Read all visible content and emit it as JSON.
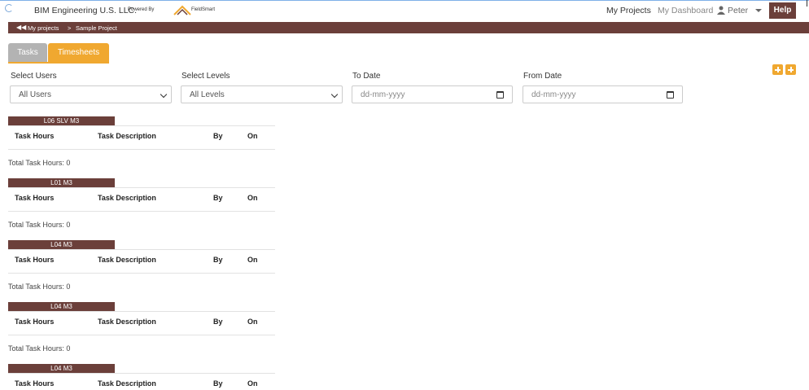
{
  "header": {
    "company": "BIM Engineering U.S. LLC.",
    "powered_by": "Powered By",
    "logo_text": "FieldSmart",
    "nav": {
      "my_projects": "My Projects",
      "my_dashboard": "My Dashboard",
      "user": "Peter",
      "help": "Help"
    }
  },
  "breadcrumb": {
    "root": "My projects",
    "separator": ">",
    "current": "Sample Project"
  },
  "tabs": [
    {
      "label": "Tasks",
      "active": false
    },
    {
      "label": "Timesheets",
      "active": true
    }
  ],
  "filters": {
    "users": {
      "label": "Select Users",
      "value": "All Users"
    },
    "levels": {
      "label": "Select Levels",
      "value": "All Levels"
    },
    "to_date": {
      "label": "To Date",
      "placeholder": "dd-mm-yyyy"
    },
    "from_date": {
      "label": "From Date",
      "placeholder": "dd-mm-yyyy"
    }
  },
  "columns": [
    "Task Hours",
    "Task Description",
    "By",
    "On"
  ],
  "levels": [
    {
      "name": "L06 SLV M3",
      "total": "Total Task Hours: 0"
    },
    {
      "name": "L01 M3",
      "total": "Total Task Hours: 0"
    },
    {
      "name": "L04 M3",
      "total": "Total Task Hours: 0"
    },
    {
      "name": "L04 M3",
      "total": "Total Task Hours: 0"
    },
    {
      "name": "L04 M3",
      "total": ""
    }
  ],
  "colors": {
    "brand": "#6b3f3a",
    "accent": "#f0a830",
    "tab_inactive": "#b3b3b3"
  },
  "icons": [
    "loading-spinner-icon",
    "user-icon",
    "caret-down-icon",
    "double-left-arrow-icon",
    "plus-icon",
    "chevron-down-icon",
    "calendar-icon"
  ]
}
